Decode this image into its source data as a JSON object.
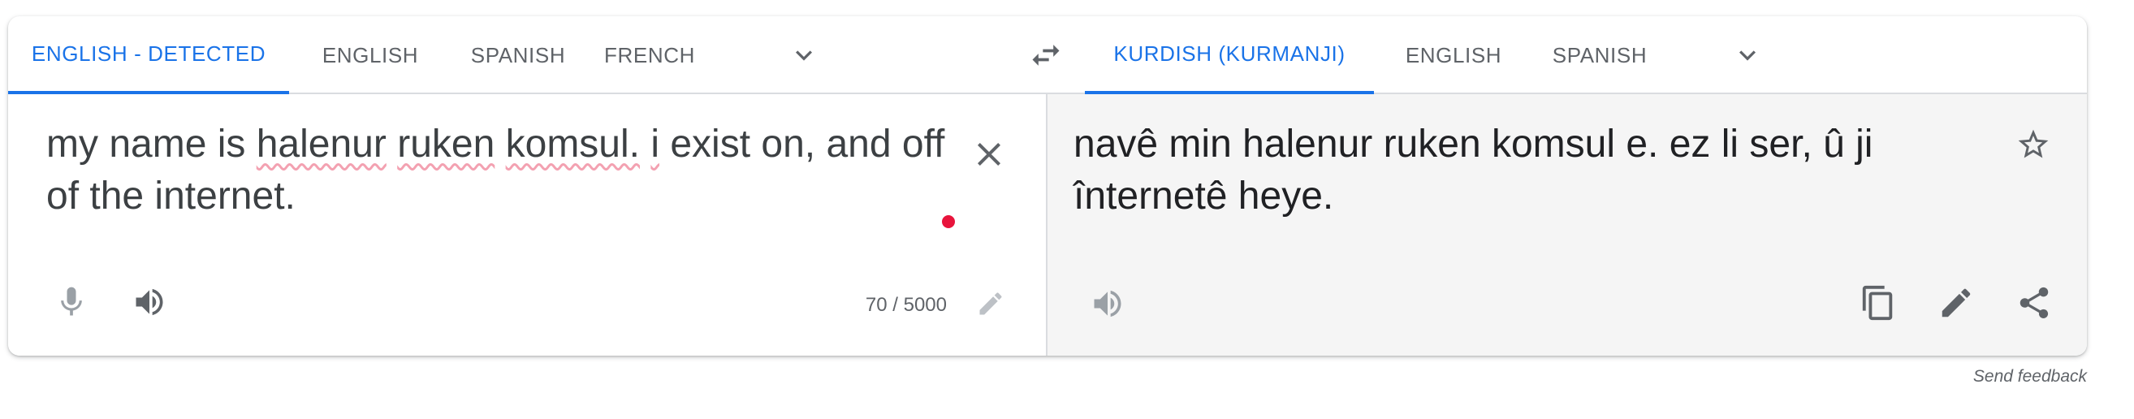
{
  "source_tabs": [
    {
      "label": "ENGLISH - DETECTED",
      "active": true
    },
    {
      "label": "ENGLISH",
      "active": false
    },
    {
      "label": "SPANISH",
      "active": false
    },
    {
      "label": "FRENCH",
      "active": false
    }
  ],
  "target_tabs": [
    {
      "label": "KURDISH (KURMANJI)",
      "active": true
    },
    {
      "label": "ENGLISH",
      "active": false
    },
    {
      "label": "SPANISH",
      "active": false
    }
  ],
  "source": {
    "w1": "my name is ",
    "w2": "halenur",
    "w3": " ",
    "w4": "ruken",
    "w5": " ",
    "w6": "komsul.",
    "w7": " ",
    "w8": "i",
    "w9": " exist on, and off of the internet.",
    "char_count": "70 / 5000"
  },
  "target": {
    "text": "navê min halenur ruken komsul e. ez li ser, û ji înternetê heye."
  },
  "footer": {
    "feedback": "Send feedback"
  },
  "icons": {
    "swap": "swap-horiz-icon",
    "close": "close-icon",
    "mic": "mic-icon",
    "speaker": "volume-up-icon",
    "edit": "edit-icon",
    "star": "star-outline-icon",
    "copy": "copy-icon",
    "share": "share-icon"
  },
  "colors": {
    "accent": "#1a73e8",
    "target_bg": "#f5f5f5",
    "spell_underline": "#f3a1b1"
  }
}
